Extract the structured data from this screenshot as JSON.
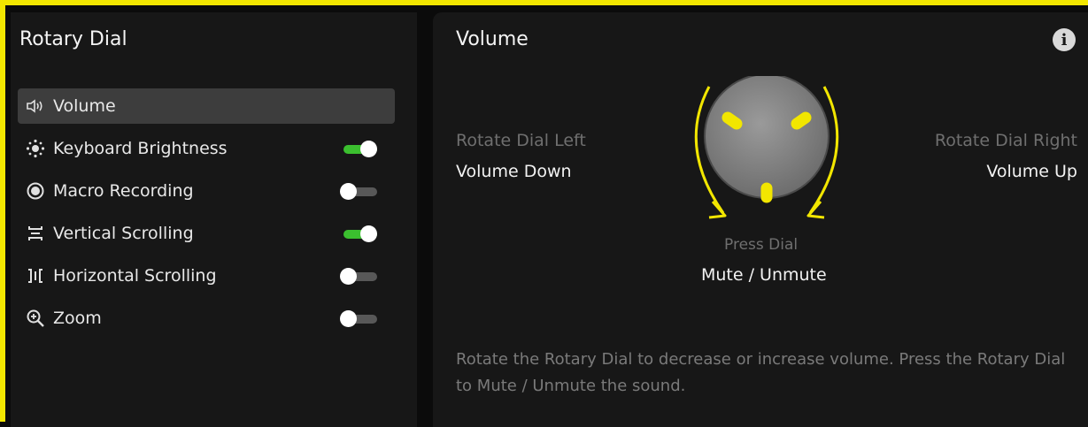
{
  "sidebar": {
    "title": "Rotary Dial",
    "items": [
      {
        "label": "Volume",
        "icon": "speaker-icon",
        "selected": true
      },
      {
        "label": "Keyboard Brightness",
        "icon": "brightness-icon",
        "toggle": "on"
      },
      {
        "label": "Macro Recording",
        "icon": "record-icon",
        "toggle": "off"
      },
      {
        "label": "Vertical Scrolling",
        "icon": "vertical-scroll-icon",
        "toggle": "on"
      },
      {
        "label": "Horizontal Scrolling",
        "icon": "horizontal-scroll-icon",
        "toggle": "off"
      },
      {
        "label": "Zoom",
        "icon": "zoom-icon",
        "toggle": "off"
      }
    ]
  },
  "detail": {
    "title": "Volume",
    "rotate_left_label": "Rotate Dial Left",
    "rotate_left_action": "Volume Down",
    "rotate_right_label": "Rotate Dial Right",
    "rotate_right_action": "Volume Up",
    "press_label": "Press Dial",
    "press_action": "Mute / Unmute",
    "description": "Rotate the Rotary Dial to decrease or increase volume. Press the Rotary Dial to Mute / Unmute the sound."
  },
  "colors": {
    "accent": "#f2e600",
    "toggle_on": "#3bbf2f",
    "panel": "#171717",
    "selected": "#3d3d3d"
  }
}
